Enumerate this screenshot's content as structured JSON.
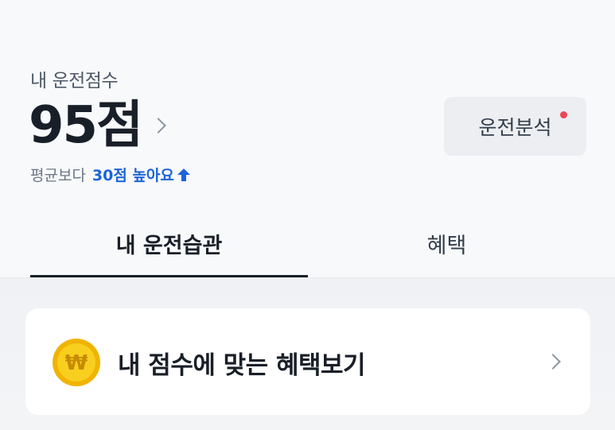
{
  "score": {
    "label": "내 운전점수",
    "value": "95점",
    "compare_prefix": "평균보다",
    "compare_highlight": "30점 높아요"
  },
  "analysis_button": {
    "label": "운전분석",
    "has_notification": true
  },
  "tabs": [
    {
      "label": "내 운전습관",
      "active": true
    },
    {
      "label": "혜택",
      "active": false
    }
  ],
  "benefit_card": {
    "title": "내 점수에 맞는 혜택보기",
    "icon": "won-coin-icon"
  },
  "colors": {
    "accent": "#1b64da",
    "notification": "#f04452",
    "coin": "#f5c518"
  }
}
